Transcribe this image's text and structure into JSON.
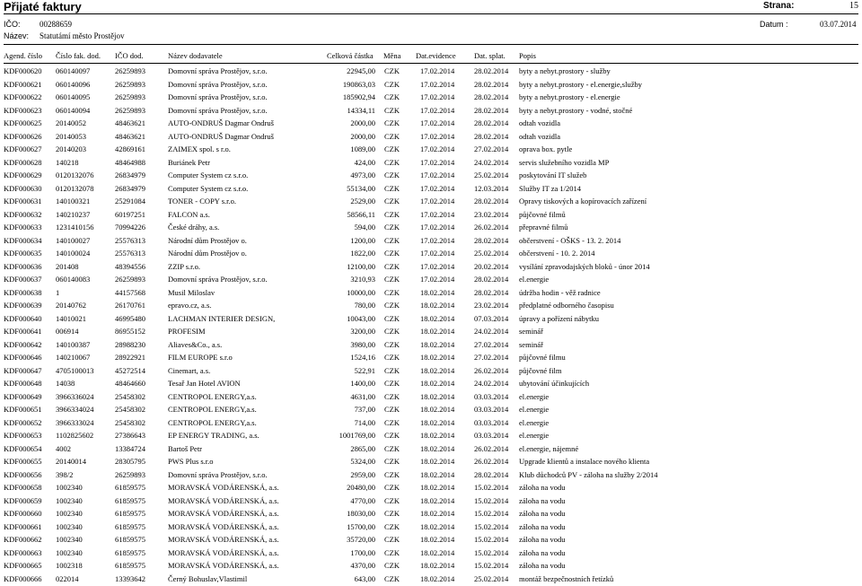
{
  "header": {
    "title": "Přijaté faktury",
    "strana_label": "Strana:",
    "strana_value": "15",
    "ico_label": "IČO:",
    "ico_value": "00288659",
    "nazev_label": "Název:",
    "nazev_value": "Statutámí město Prostějov",
    "datum_label": "Datum :",
    "datum_value": "03.07.2014"
  },
  "columns": {
    "agenda": "Agend. číslo",
    "cislo_fak": "Číslo fak. dod.",
    "ico_dod": "IČO dod.",
    "nazev_dod": "Název dodavatele",
    "castka": "Celková částka",
    "mena": "Měna",
    "evidence": "Dat.evidence",
    "splat": "Dat. splat.",
    "popis": "Popis"
  },
  "rows": [
    {
      "a": "KDF000620",
      "f": "060140097",
      "i": "26259893",
      "n": "Domovní správa Prostějov, s.r.o.",
      "c": "22945,00",
      "m": "CZK",
      "e": "17.02.2014",
      "s": "28.02.2014",
      "p": "byty a nebyt.prostory - služby"
    },
    {
      "a": "KDF000621",
      "f": "060140096",
      "i": "26259893",
      "n": "Domovní správa Prostějov, s.r.o.",
      "c": "190863,03",
      "m": "CZK",
      "e": "17.02.2014",
      "s": "28.02.2014",
      "p": "byty a nebyt.prostory - el.energie,služby"
    },
    {
      "a": "KDF000622",
      "f": "060140095",
      "i": "26259893",
      "n": "Domovní správa Prostějov, s.r.o.",
      "c": "185902,94",
      "m": "CZK",
      "e": "17.02.2014",
      "s": "28.02.2014",
      "p": "byty a nebyt.prostory - el.energie"
    },
    {
      "a": "KDF000623",
      "f": "060140094",
      "i": "26259893",
      "n": "Domovní správa Prostějov, s.r.o.",
      "c": "14334,11",
      "m": "CZK",
      "e": "17.02.2014",
      "s": "28.02.2014",
      "p": "byty a nebyt.prostory - vodné, stočné"
    },
    {
      "a": "KDF000625",
      "f": "20140052",
      "i": "48463621",
      "n": "AUTO-ONDRUŠ Dagmar Ondruš",
      "c": "2000,00",
      "m": "CZK",
      "e": "17.02.2014",
      "s": "28.02.2014",
      "p": "odtah vozidla"
    },
    {
      "a": "KDF000626",
      "f": "20140053",
      "i": "48463621",
      "n": "AUTO-ONDRUŠ Dagmar Ondruš",
      "c": "2000,00",
      "m": "CZK",
      "e": "17.02.2014",
      "s": "28.02.2014",
      "p": "odtah vozidla"
    },
    {
      "a": "KDF000627",
      "f": "20140203",
      "i": "42869161",
      "n": "ZAIMEX spol. s r.o.",
      "c": "1089,00",
      "m": "CZK",
      "e": "17.02.2014",
      "s": "27.02.2014",
      "p": "oprava box. pytle"
    },
    {
      "a": "KDF000628",
      "f": "140218",
      "i": "48464988",
      "n": "Buriánek Petr",
      "c": "424,00",
      "m": "CZK",
      "e": "17.02.2014",
      "s": "24.02.2014",
      "p": "servis služebního vozidla MP"
    },
    {
      "a": "KDF000629",
      "f": "0120132076",
      "i": "26834979",
      "n": "Computer System cz s.r.o.",
      "c": "4973,00",
      "m": "CZK",
      "e": "17.02.2014",
      "s": "25.02.2014",
      "p": "poskytování IT služeb"
    },
    {
      "a": "KDF000630",
      "f": "0120132078",
      "i": "26834979",
      "n": "Computer System cz s.r.o.",
      "c": "55134,00",
      "m": "CZK",
      "e": "17.02.2014",
      "s": "12.03.2014",
      "p": "Služby IT za 1/2014"
    },
    {
      "a": "KDF000631",
      "f": "140100321",
      "i": "25291084",
      "n": "TONER - COPY s.r.o.",
      "c": "2529,00",
      "m": "CZK",
      "e": "17.02.2014",
      "s": "28.02.2014",
      "p": "Opravy tiskových a kopírovacích zařízení"
    },
    {
      "a": "KDF000632",
      "f": "140210237",
      "i": "60197251",
      "n": "FALCON a.s.",
      "c": "58566,11",
      "m": "CZK",
      "e": "17.02.2014",
      "s": "23.02.2014",
      "p": "půjčovné filmů"
    },
    {
      "a": "KDF000633",
      "f": "1231410156",
      "i": "70994226",
      "n": "České dráhy, a.s.",
      "c": "594,00",
      "m": "CZK",
      "e": "17.02.2014",
      "s": "26.02.2014",
      "p": "přepravné filmů"
    },
    {
      "a": "KDF000634",
      "f": "140100027",
      "i": "25576313",
      "n": "Národní dům Prostějov o.",
      "c": "1200,00",
      "m": "CZK",
      "e": "17.02.2014",
      "s": "28.02.2014",
      "p": "občerstvení - OŠKS - 13. 2. 2014"
    },
    {
      "a": "KDF000635",
      "f": "140100024",
      "i": "25576313",
      "n": "Národní dům Prostějov o.",
      "c": "1822,00",
      "m": "CZK",
      "e": "17.02.2014",
      "s": "25.02.2014",
      "p": "občerstvení - 10. 2. 2014"
    },
    {
      "a": "KDF000636",
      "f": "201408",
      "i": "48394556",
      "n": "ZZIP s.r.o.",
      "c": "12100,00",
      "m": "CZK",
      "e": "17.02.2014",
      "s": "20.02.2014",
      "p": "vysílání zpravodajských bloků - únor 2014"
    },
    {
      "a": "KDF000637",
      "f": "060140083",
      "i": "26259893",
      "n": "Domovní správa Prostějov, s.r.o.",
      "c": "3210,93",
      "m": "CZK",
      "e": "17.02.2014",
      "s": "28.02.2014",
      "p": "el.energie"
    },
    {
      "a": "KDF000638",
      "f": "1",
      "i": "44157568",
      "n": "Musil Miloslav",
      "c": "10000,00",
      "m": "CZK",
      "e": "18.02.2014",
      "s": "28.02.2014",
      "p": "údržba hodin - věž radnice"
    },
    {
      "a": "KDF000639",
      "f": "20140762",
      "i": "26170761",
      "n": "epravo.cz, a.s.",
      "c": "780,00",
      "m": "CZK",
      "e": "18.02.2014",
      "s": "23.02.2014",
      "p": "předplatné odborného časopisu"
    },
    {
      "a": "KDF000640",
      "f": "14010021",
      "i": "46995480",
      "n": "LACHMAN INTERIER DESIGN,",
      "c": "10043,00",
      "m": "CZK",
      "e": "18.02.2014",
      "s": "07.03.2014",
      "p": "úpravy a pořízení nábytku"
    },
    {
      "a": "KDF000641",
      "f": "006914",
      "i": "86955152",
      "n": "PROFESIM",
      "c": "3200,00",
      "m": "CZK",
      "e": "18.02.2014",
      "s": "24.02.2014",
      "p": "seminář"
    },
    {
      "a": "KDF000642",
      "f": "140100387",
      "i": "28988230",
      "n": "Aliaves&Co., a.s.",
      "c": "3980,00",
      "m": "CZK",
      "e": "18.02.2014",
      "s": "27.02.2014",
      "p": "seminář"
    },
    {
      "a": "KDF000646",
      "f": "140210067",
      "i": "28922921",
      "n": "FILM EUROPE s.r.o",
      "c": "1524,16",
      "m": "CZK",
      "e": "18.02.2014",
      "s": "27.02.2014",
      "p": "půjčovné filmu"
    },
    {
      "a": "KDF000647",
      "f": "4705100013",
      "i": "45272514",
      "n": "Cinemart, a.s.",
      "c": "522,91",
      "m": "CZK",
      "e": "18.02.2014",
      "s": "26.02.2014",
      "p": "půjčovné film"
    },
    {
      "a": "KDF000648",
      "f": "14038",
      "i": "48464660",
      "n": "Tesař Jan Hotel AVION",
      "c": "1400,00",
      "m": "CZK",
      "e": "18.02.2014",
      "s": "24.02.2014",
      "p": "ubytování účinkujících"
    },
    {
      "a": "KDF000649",
      "f": "3966336024",
      "i": "25458302",
      "n": "CENTROPOL ENERGY,a.s.",
      "c": "4631,00",
      "m": "CZK",
      "e": "18.02.2014",
      "s": "03.03.2014",
      "p": "el.energie"
    },
    {
      "a": "KDF000651",
      "f": "3966334024",
      "i": "25458302",
      "n": "CENTROPOL ENERGY,a.s.",
      "c": "737,00",
      "m": "CZK",
      "e": "18.02.2014",
      "s": "03.03.2014",
      "p": "el.energie"
    },
    {
      "a": "KDF000652",
      "f": "3966333024",
      "i": "25458302",
      "n": "CENTROPOL ENERGY,a.s.",
      "c": "714,00",
      "m": "CZK",
      "e": "18.02.2014",
      "s": "03.03.2014",
      "p": "el.energie"
    },
    {
      "a": "KDF000653",
      "f": "1102825602",
      "i": "27386643",
      "n": "EP ENERGY TRADING, a.s.",
      "c": "1001769,00",
      "m": "CZK",
      "e": "18.02.2014",
      "s": "03.03.2014",
      "p": "el.energie"
    },
    {
      "a": "KDF000654",
      "f": "4002",
      "i": "13384724",
      "n": "Bartoš Petr",
      "c": "2865,00",
      "m": "CZK",
      "e": "18.02.2014",
      "s": "26.02.2014",
      "p": "el.energie, nájemné"
    },
    {
      "a": "KDF000655",
      "f": "20140014",
      "i": "28305795",
      "n": "PWS Plus s.r.o",
      "c": "5324,00",
      "m": "CZK",
      "e": "18.02.2014",
      "s": "26.02.2014",
      "p": "Upgrade klientů a instalace nového klienta"
    },
    {
      "a": "KDF000656",
      "f": "398/2",
      "i": "26259893",
      "n": "Domovní správa Prostějov, s.r.o.",
      "c": "2959,00",
      "m": "CZK",
      "e": "18.02.2014",
      "s": "28.02.2014",
      "p": "Klub důchodců PV - záloha na služby 2/2014"
    },
    {
      "a": "KDF000658",
      "f": "1002340",
      "i": "61859575",
      "n": "MORAVSKÁ VODÁRENSKÁ, a.s.",
      "c": "20480,00",
      "m": "CZK",
      "e": "18.02.2014",
      "s": "15.02.2014",
      "p": "záloha na vodu"
    },
    {
      "a": "KDF000659",
      "f": "1002340",
      "i": "61859575",
      "n": "MORAVSKÁ VODÁRENSKÁ, a.s.",
      "c": "4770,00",
      "m": "CZK",
      "e": "18.02.2014",
      "s": "15.02.2014",
      "p": "záloha na vodu"
    },
    {
      "a": "KDF000660",
      "f": "1002340",
      "i": "61859575",
      "n": "MORAVSKÁ VODÁRENSKÁ, a.s.",
      "c": "18030,00",
      "m": "CZK",
      "e": "18.02.2014",
      "s": "15.02.2014",
      "p": "záloha na vodu"
    },
    {
      "a": "KDF000661",
      "f": "1002340",
      "i": "61859575",
      "n": "MORAVSKÁ VODÁRENSKÁ, a.s.",
      "c": "15700,00",
      "m": "CZK",
      "e": "18.02.2014",
      "s": "15.02.2014",
      "p": "záloha na vodu"
    },
    {
      "a": "KDF000662",
      "f": "1002340",
      "i": "61859575",
      "n": "MORAVSKÁ VODÁRENSKÁ, a.s.",
      "c": "35720,00",
      "m": "CZK",
      "e": "18.02.2014",
      "s": "15.02.2014",
      "p": "záloha na vodu"
    },
    {
      "a": "KDF000663",
      "f": "1002340",
      "i": "61859575",
      "n": "MORAVSKÁ VODÁRENSKÁ, a.s.",
      "c": "1700,00",
      "m": "CZK",
      "e": "18.02.2014",
      "s": "15.02.2014",
      "p": "záloha na vodu"
    },
    {
      "a": "KDF000665",
      "f": "1002318",
      "i": "61859575",
      "n": "MORAVSKÁ VODÁRENSKÁ, a.s.",
      "c": "4370,00",
      "m": "CZK",
      "e": "18.02.2014",
      "s": "15.02.2014",
      "p": "záloha na vodu"
    },
    {
      "a": "KDF000666",
      "f": "022014",
      "i": "13393642",
      "n": "Černý Bohuslav,Vlastimil",
      "c": "643,00",
      "m": "CZK",
      "e": "18.02.2014",
      "s": "25.02.2014",
      "p": "montáž bezpečnostních řetízků"
    }
  ]
}
